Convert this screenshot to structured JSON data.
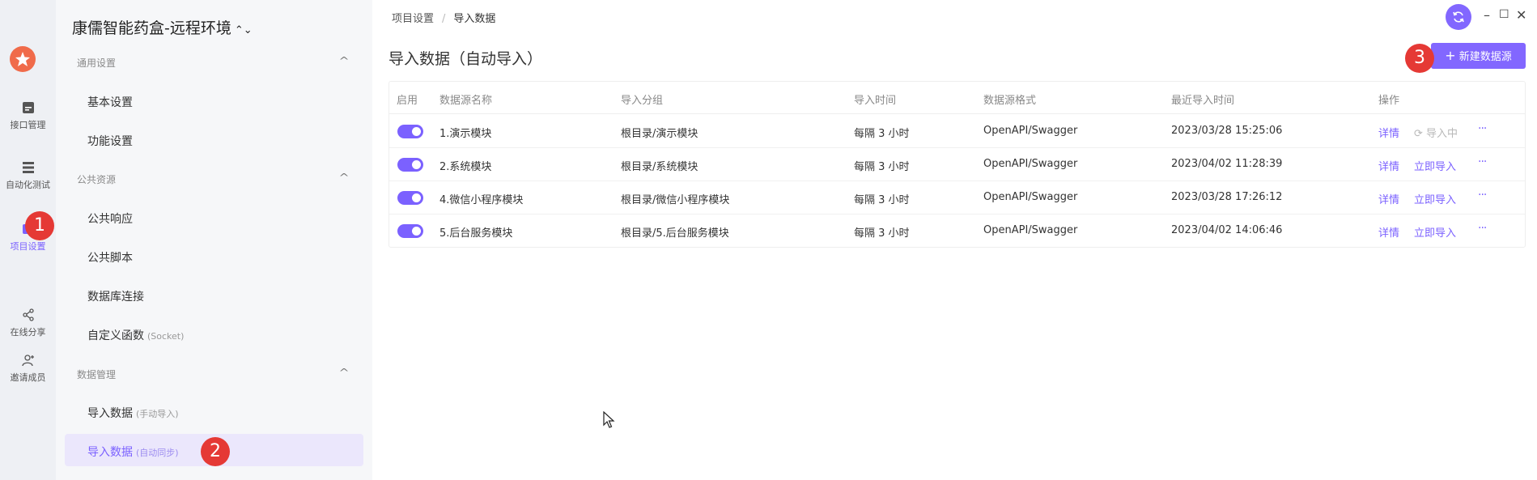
{
  "rail": {
    "items": [
      {
        "label": "接口管理",
        "icon": "api-icon"
      },
      {
        "label": "自动化测试",
        "icon": "automation-icon"
      },
      {
        "label": "项目设置",
        "icon": "settings-icon"
      },
      {
        "label": "在线分享",
        "icon": "share-icon"
      },
      {
        "label": "邀请成员",
        "icon": "invite-icon"
      }
    ]
  },
  "sidebar": {
    "project_title": "康儒智能药盒-远程环境",
    "switch_glyph": "⌃⌄",
    "groups": [
      {
        "title": "通用设置",
        "items": [
          {
            "label": "基本设置",
            "sub": ""
          },
          {
            "label": "功能设置",
            "sub": ""
          }
        ]
      },
      {
        "title": "公共资源",
        "items": [
          {
            "label": "公共响应",
            "sub": ""
          },
          {
            "label": "公共脚本",
            "sub": ""
          },
          {
            "label": "数据库连接",
            "sub": ""
          },
          {
            "label": "自定义函数",
            "sub": "(Socket)"
          }
        ]
      },
      {
        "title": "数据管理",
        "items": [
          {
            "label": "导入数据",
            "sub": "(手动导入)"
          },
          {
            "label": "导入数据",
            "sub": "(自动同步)"
          }
        ]
      }
    ]
  },
  "breadcrumb": {
    "parent": "项目设置",
    "separator": "/",
    "current": "导入数据"
  },
  "page": {
    "title": "导入数据（自动导入）",
    "new_button": "新建数据源"
  },
  "table": {
    "headers": [
      "启用",
      "数据源名称",
      "导入分组",
      "导入时间",
      "数据源格式",
      "最近导入时间",
      "操作"
    ],
    "rows": [
      {
        "name": "1.演示模块",
        "group": "根目录/演示模块",
        "interval": "每隔 3 小时",
        "format": "OpenAPI/Swagger",
        "last": "2023/03/28 15:25:06",
        "detail": "详情",
        "action": "导入中",
        "action_disabled": true
      },
      {
        "name": "2.系统模块",
        "group": "根目录/系统模块",
        "interval": "每隔 3 小时",
        "format": "OpenAPI/Swagger",
        "last": "2023/04/02 11:28:39",
        "detail": "详情",
        "action": "立即导入",
        "action_disabled": false
      },
      {
        "name": "4.微信小程序模块",
        "group": "根目录/微信小程序模块",
        "interval": "每隔 3 小时",
        "format": "OpenAPI/Swagger",
        "last": "2023/03/28 17:26:12",
        "detail": "详情",
        "action": "立即导入",
        "action_disabled": false
      },
      {
        "name": "5.后台服务模块",
        "group": "根目录/5.后台服务模块",
        "interval": "每隔 3 小时",
        "format": "OpenAPI/Swagger",
        "last": "2023/04/02 14:06:46",
        "detail": "详情",
        "action": "立即导入",
        "action_disabled": false
      }
    ],
    "more_glyph": "···"
  },
  "badges": [
    "1",
    "2",
    "3"
  ],
  "window": {
    "minimize": "–",
    "maximize": "☐",
    "close": "✕"
  },
  "colors": {
    "accent": "#7b61ff",
    "badge": "#e53935",
    "logo": "#f06b4a"
  }
}
